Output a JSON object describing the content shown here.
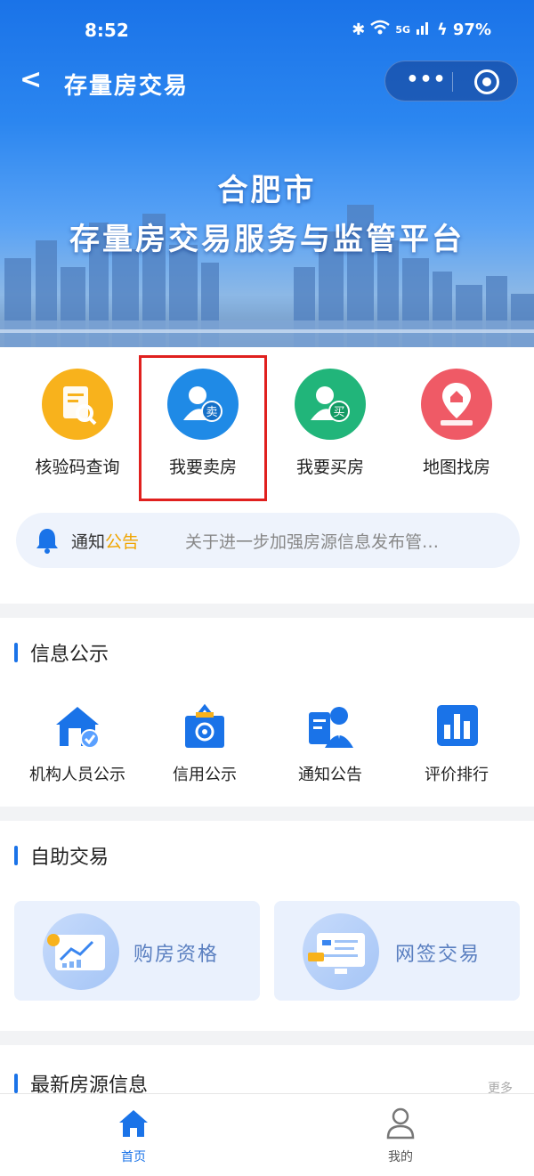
{
  "status_bar": {
    "time": "8:52",
    "signal": "5G",
    "battery": "97%"
  },
  "nav": {
    "back": "<",
    "title": "存量房交易",
    "more": "•••"
  },
  "banner": {
    "line1": "合肥市",
    "line2": "存量房交易服务与监管平台"
  },
  "quick_actions": [
    {
      "label": "核验码查询",
      "color": "#f8b21c"
    },
    {
      "label": "我要卖房",
      "color": "#1f8ae6",
      "badge": "卖"
    },
    {
      "label": "我要买房",
      "color": "#21b57a",
      "badge": "买"
    },
    {
      "label": "地图找房",
      "color": "#ef5a66"
    }
  ],
  "notice": {
    "title_prefix": "通知",
    "title_highlight": "公告",
    "text": "关于进一步加强房源信息发布管…"
  },
  "info_section": {
    "title": "信息公示",
    "items": [
      {
        "label": "机构人员公示",
        "icon": "agency-icon"
      },
      {
        "label": "信用公示",
        "icon": "credit-icon"
      },
      {
        "label": "通知公告",
        "icon": "announcement-icon"
      },
      {
        "label": "评价排行",
        "icon": "ranking-icon"
      }
    ]
  },
  "self_section": {
    "title": "自助交易",
    "cards": [
      {
        "label": "购房资格"
      },
      {
        "label": "网签交易"
      }
    ]
  },
  "listings_section": {
    "title": "最新房源信息",
    "more": "更多"
  },
  "tabbar": [
    {
      "label": "首页",
      "active": true
    },
    {
      "label": "我的",
      "active": false
    }
  ],
  "colors": {
    "primary": "#1a73e8",
    "highlight_border": "#e0201e",
    "notice_accent": "#f0a500"
  }
}
